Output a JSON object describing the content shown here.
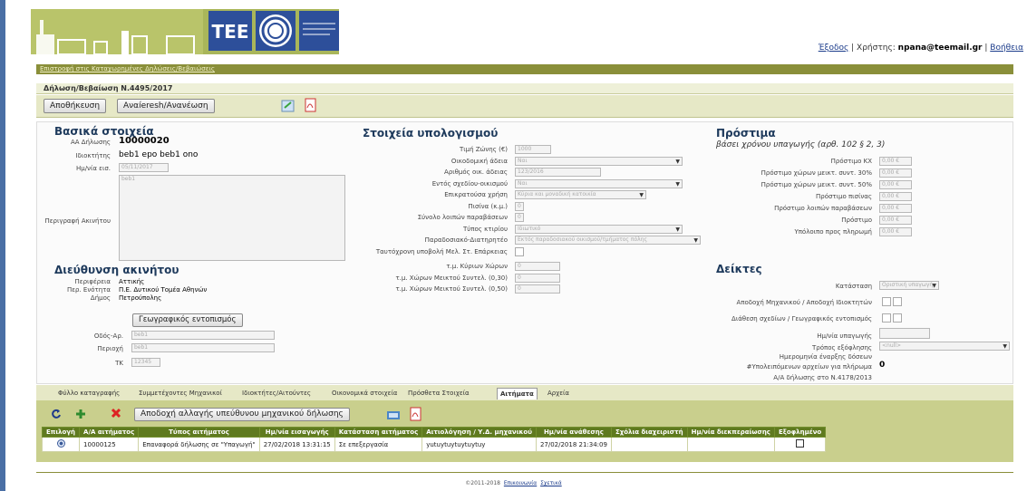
{
  "header": {
    "logout": "Έξοδος",
    "user_label": "Χρήστης:",
    "user": "npana@teemail.gr",
    "help": "Βοήθεια"
  },
  "nav": {
    "back_link": "Επιστροφή στις Καταχωρημένες Δηλώσεις/Βεβαιώσεις"
  },
  "page": {
    "title": "Δήλωση/Βεβαίωση Ν.4495/2017"
  },
  "toolbar": {
    "save": "Αποθήκευση",
    "refresh": "Αναíeresh/Ανανέωση"
  },
  "basic": {
    "title": "Βασικά στοιχεία",
    "aa_label": "ΑΑ Δήλωσης",
    "aa_value": "10000020",
    "owner_label": "Ιδιοκτήτης",
    "owner_value": "beb1 epo beb1 ono",
    "date_label": "Ημ/νία εισ.",
    "date_value": "05/11/2017",
    "desc_label": "Περιγραφή Ακινήτου",
    "desc_value": "beb1"
  },
  "address": {
    "title": "Διεύθυνση ακινήτου",
    "region_label": "Περιφέρεια",
    "region_value": "Αττικής",
    "unit_label": "Περ. Ενότητα",
    "unit_value": "Π.Ε. Δυτικού Τομέα Αθηνών",
    "municipality_label": "Δήμος",
    "municipality_value": "Πετρούπολης",
    "geo_button": "Γεωγραφικός εντοπισμός",
    "street_label": "Οδός-Αρ.",
    "street_value": "beb1",
    "area_label": "Περιοχή",
    "area_value": "beb1",
    "tk_label": "ΤΚ",
    "tk_value": "12345"
  },
  "calc": {
    "title": "Στοιχεία υπολογισμού",
    "rows": [
      {
        "label": "Τιμή Ζώνης (€)",
        "value": "1000",
        "kind": "input",
        "w": 40
      },
      {
        "label": "Οικοδομική άδεια",
        "value": "Ναι",
        "kind": "select",
        "w": 185
      },
      {
        "label": "Αριθμός οικ. άδειας",
        "value": "123/2016",
        "kind": "input",
        "w": 95
      },
      {
        "label": "Εντός σχεδίου-οικισμού",
        "value": "Ναι",
        "kind": "select",
        "w": 185
      },
      {
        "label": "Επικρατούσα χρήση",
        "value": "Κύρια και μοναδική κατοικία",
        "kind": "select",
        "w": 145
      },
      {
        "label": "Πισίνα (κ.μ.)",
        "value": "0",
        "kind": "input",
        "w": 10
      },
      {
        "label": "Σύνολο λοιπών παραβάσεων",
        "value": "0",
        "kind": "input",
        "w": 10
      },
      {
        "label": "Τύπος κτιρίου",
        "value": "Ιδιωτικό",
        "kind": "select",
        "w": 185
      },
      {
        "label": "Παραδοσιακό-Διατηρητέο",
        "value": "Εκτός παραδοσιακού οικισμού/τμήματος πόλης",
        "kind": "select",
        "w": 205
      },
      {
        "label": "Ταυτόχρονη υποβολή Μελ. Στ. Επάρκειας",
        "value": "",
        "kind": "check",
        "w": 12
      },
      {
        "label": "τ.μ. Κύριων Χώρων",
        "value": "0",
        "kind": "input",
        "w": 50
      },
      {
        "label": "τ.μ. Χώρων Μεικτού Συντελ. (0,30)",
        "value": "0",
        "kind": "input",
        "w": 50
      },
      {
        "label": "τ.μ. Χώρων Μεικτού Συντελ. (0,50)",
        "value": "0",
        "kind": "input",
        "w": 50
      }
    ]
  },
  "fines": {
    "title": "Πρόστιμα",
    "subtitle": "βάσει χρόνου υπαγωγής (αρθ. 102 § 2, 3)",
    "rows": [
      {
        "label": "Πρόστιμο ΚΧ",
        "value": "0,00 €"
      },
      {
        "label": "Πρόστιμο χώρων μεικτ. συντ. 30%",
        "value": "0,00 €"
      },
      {
        "label": "Πρόστιμο χώρων μεικτ. συντ. 50%",
        "value": "0,00 €"
      },
      {
        "label": "Πρόστιμο πισίνας",
        "value": "0,00 €"
      },
      {
        "label": "Πρόστιμο λοιπών παραβάσεων",
        "value": "0,00 €"
      },
      {
        "label": "Πρόστιμο",
        "value": "0,00 €"
      },
      {
        "label": "Υπόλοιπο προς πληρωμή",
        "value": "0,00 €"
      }
    ]
  },
  "indicators": {
    "title": "Δείκτες",
    "status_label": "Κατάσταση",
    "status_value": "Οριστική υπαγωγή",
    "accept_label": "Αποδοχή Μηχανικού / Αποδοχή Ιδιοκτητών",
    "layout_label": "Διάθεση σχεδίων / Γεωγραφικός εντοπισμός",
    "date_label": "Ημ/νία υπαγωγής",
    "settle_label": "Τρόπος εξόφλησης",
    "settle_value": "<null>",
    "start_label": "Ημερομηνία έναρξης δόσεων",
    "pending_label": "#Υπολειπόμενων αρχείων για πλήρωμα",
    "pending_value": "0",
    "aa_label": "Α/Α δήλωσης στο Ν.4178/2013"
  },
  "tabs": [
    "Φύλλο καταγραφής",
    "Συμμετέχοντες Μηχανικοί",
    "Ιδιοκτήτες/Αιτούντες",
    "Οικονομικά στοιχεία",
    "Πρόσθετα Στοιχεία",
    "Αιτήματα",
    "Αρχεία"
  ],
  "requests": {
    "accept_button": "Αποδοχή αλλαγής υπεύθυνου μηχανικού δήλωσης",
    "columns": [
      "Επιλογή",
      "Α/Α αιτήματος",
      "Τύπος αιτήματος",
      "Ημ/νία εισαγωγής",
      "Κατάσταση αιτήματος",
      "Αιτιολόγηση / Υ.Δ. μηχανικού",
      "Ημ/νία ανάθεσης",
      "Σχόλια διαχειριστή",
      "Ημ/νία διεκπεραίωσης",
      "Εξοφλημένο"
    ],
    "rows": [
      [
        "",
        "10000125",
        "Επαναφορά δήλωσης σε \"Υπαγωγή\"",
        "27/02/2018 13:31:15",
        "Σε επεξεργασία",
        "yutuytuytuytuytuy",
        "27/02/2018 21:34:09",
        "",
        "",
        ""
      ]
    ]
  },
  "footer": {
    "copy": "©2011-2018",
    "contact": "Επικοινωνία",
    "about": "Σχετικά"
  },
  "colors": {
    "olive": "#8a8f3a",
    "header_green": "#5f7a1f",
    "title_blue": "#1e3a5c"
  }
}
